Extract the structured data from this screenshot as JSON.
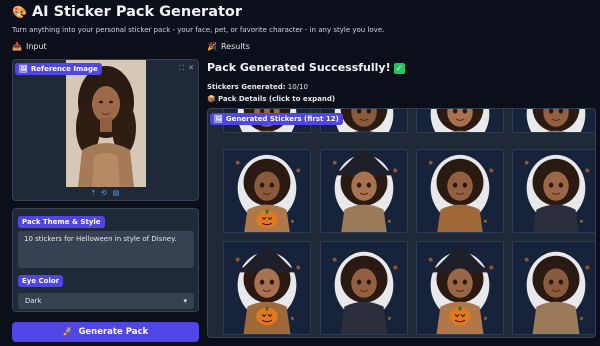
{
  "header": {
    "title": "AI Sticker Pack Generator",
    "title_icon": "palette-icon",
    "subtitle": "Turn anything into your personal sticker pack - your face, pet, or favorite character - in any style you love."
  },
  "input": {
    "section_label": "Input",
    "image_label": "Reference Image",
    "theme_label": "Pack Theme & Style",
    "theme_value": "10 stickers for Helloween in style of Disney.",
    "eye_label": "Eye Color",
    "eye_value": "Dark",
    "generate_label": "Generate Pack"
  },
  "results": {
    "section_label": "Results",
    "status": "Pack Generated Successfully!",
    "stickers_label": "Stickers Generated:",
    "stickers_value": "10/10",
    "details_label": "Pack Details (click to expand)",
    "gallery_label": "Generated Stickers (first 12)"
  },
  "colors": {
    "background": "#0b0f19",
    "panel": "#1f2937",
    "accent": "#4f46e5",
    "success": "#22c55e"
  }
}
